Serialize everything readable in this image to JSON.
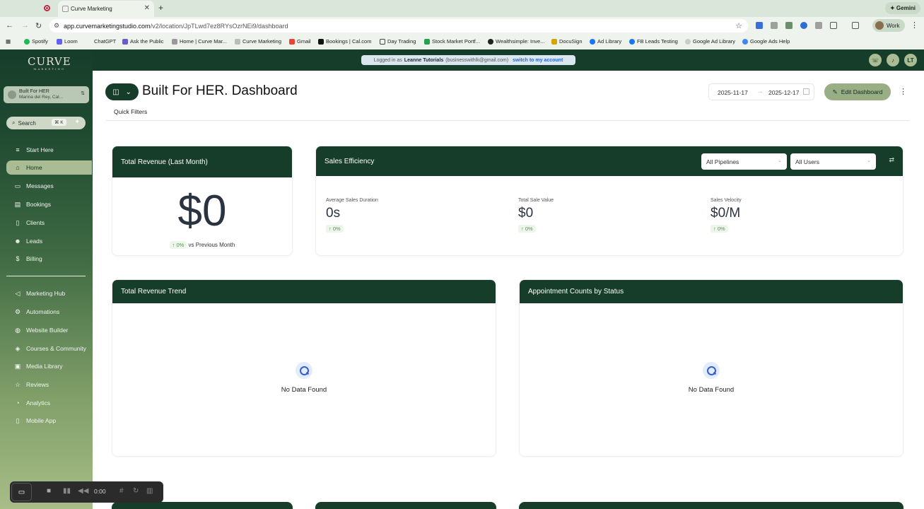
{
  "browser": {
    "tab_title": "Curve Marketing",
    "url_host": "app.curvemarketingstudio.com",
    "url_path": "/v2/location/JpTLwd7ez8RYsOzrNEi9/dashboard",
    "gemini_label": "Gemini",
    "profile_label": "Work",
    "bookmarks": [
      "Spotify",
      "Loom",
      "ChatGPT",
      "Ask the Public",
      "Home | Curve Mar...",
      "Curve Marketing",
      "Gmail",
      "Bookings | Cal.com",
      "Day Trading",
      "Stock Market Portf...",
      "Wealthsimple: Inve...",
      "DocuSign",
      "Ad Library",
      "FB Leads Testing",
      "Google Ad Library",
      "Google Ads Help"
    ]
  },
  "sidebar": {
    "logo": "CURVE",
    "logo_sub": "MARKETING",
    "account_name": "Built For HER",
    "account_location": "Marina del Rey, Cal...",
    "search_label": "Search",
    "search_shortcut": "⌘ K",
    "items": [
      {
        "label": "Start Here",
        "icon": "sliders-icon"
      },
      {
        "label": "Home",
        "icon": "home-icon"
      },
      {
        "label": "Messages",
        "icon": "chat-icon"
      },
      {
        "label": "Bookings",
        "icon": "calendar-icon"
      },
      {
        "label": "Clients",
        "icon": "clipboard-icon"
      },
      {
        "label": "Leads",
        "icon": "users-icon"
      },
      {
        "label": "Billing",
        "icon": "dollar-icon"
      },
      {
        "label": "Marketing Hub",
        "icon": "megaphone-icon"
      },
      {
        "label": "Automations",
        "icon": "automation-icon"
      },
      {
        "label": "Website Builder",
        "icon": "globe-icon"
      },
      {
        "label": "Courses & Community",
        "icon": "courses-icon"
      },
      {
        "label": "Media Library",
        "icon": "image-icon"
      },
      {
        "label": "Reviews",
        "icon": "star-icon"
      },
      {
        "label": "Analytics",
        "icon": "analytics-icon"
      },
      {
        "label": "Mobile App",
        "icon": "phone-icon"
      }
    ]
  },
  "banner": {
    "prefix": "Logged in as",
    "user": "Leanne Tutorials",
    "email": "(businesswithlk@gmail.com)",
    "switch": "switch to my account"
  },
  "header": {
    "avatar_initials": "LT",
    "dashboard_title": "Built For HER. Dashboard",
    "quick_filters": "Quick Filters",
    "date_start": "2025-11-17",
    "date_end": "2025-12-17",
    "edit_label": "Edit Dashboard"
  },
  "revenue_card": {
    "title": "Total Revenue (Last Month)",
    "value": "$0",
    "change": "↑ 0%",
    "compare": "vs Previous Month"
  },
  "sales_card": {
    "title": "Sales Efficiency",
    "pipeline_select": "All Pipelines",
    "user_select": "All Users",
    "metrics": [
      {
        "label": "Average Sales Duration",
        "value": "0s",
        "change": "↑ 0%"
      },
      {
        "label": "Total Sale Value",
        "value": "$0",
        "change": "↑ 0%"
      },
      {
        "label": "Sales Velocity",
        "value": "$0/M",
        "change": "↑ 0%"
      }
    ]
  },
  "trend_card": {
    "title": "Total Revenue Trend",
    "empty": "No Data Found"
  },
  "appt_card": {
    "title": "Appointment Counts by Status",
    "empty": "No Data Found"
  },
  "recorder": {
    "time": "0:00"
  }
}
